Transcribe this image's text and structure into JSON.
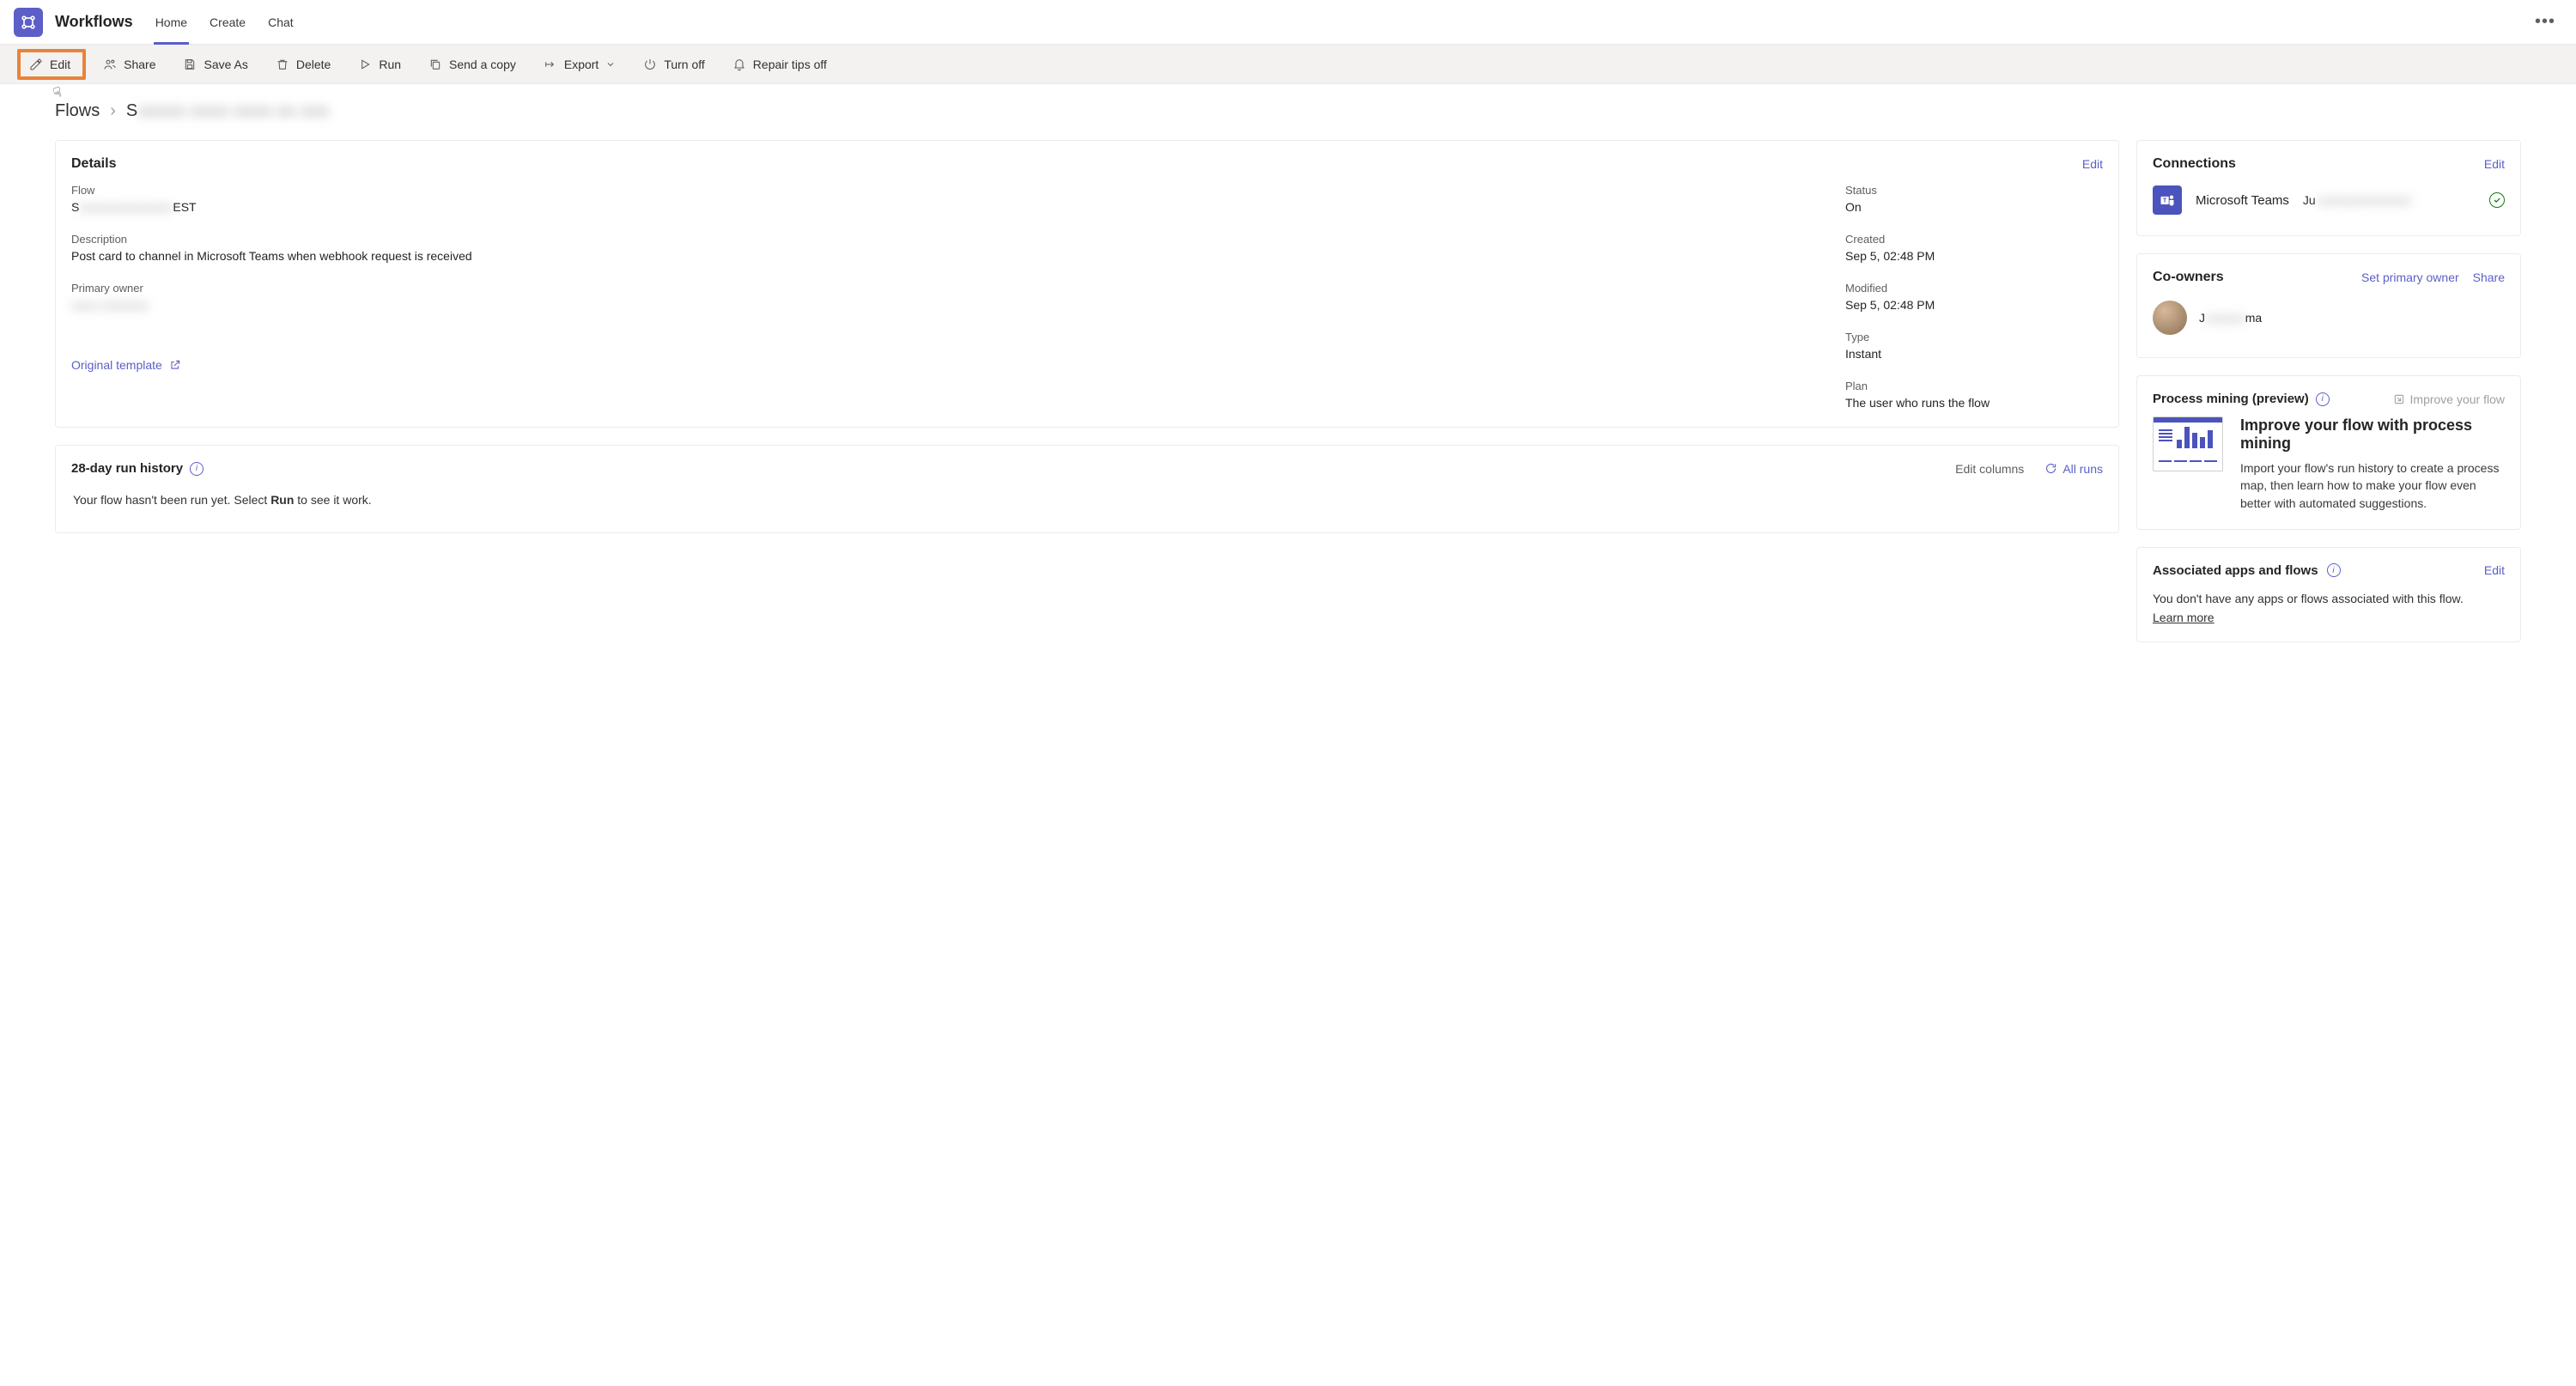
{
  "app": {
    "title": "Workflows"
  },
  "nav": {
    "tabs": {
      "home": "Home",
      "create": "Create",
      "chat": "Chat"
    }
  },
  "toolbar": {
    "edit": "Edit",
    "share": "Share",
    "save_as": "Save As",
    "delete": "Delete",
    "run": "Run",
    "send_copy": "Send a copy",
    "export": "Export",
    "turn_off": "Turn off",
    "repair_tips_off": "Repair tips off"
  },
  "breadcrumb": {
    "flows": "Flows",
    "current_prefix": "S",
    "current_blurred": "aaaaa aaaa aaaa aa aaa"
  },
  "details": {
    "title": "Details",
    "edit": "Edit",
    "flow_label": "Flow",
    "flow_value_prefix": "S",
    "flow_value_blurred": "aaaaaaaaaaaaaa",
    "flow_value_suffix": "EST",
    "description_label": "Description",
    "description_value": "Post card to channel in Microsoft Teams when webhook request is received",
    "primary_owner_label": "Primary owner",
    "primary_owner_value": "aaaa aaaaaaa",
    "status_label": "Status",
    "status_value": "On",
    "created_label": "Created",
    "created_value": "Sep 5, 02:48 PM",
    "modified_label": "Modified",
    "modified_value": "Sep 5, 02:48 PM",
    "type_label": "Type",
    "type_value": "Instant",
    "plan_label": "Plan",
    "plan_value": "The user who runs the flow",
    "original_template": "Original template"
  },
  "runhist": {
    "title": "28-day run history",
    "edit_columns": "Edit columns",
    "all_runs": "All runs",
    "empty_pre": "Your flow hasn't been run yet. Select ",
    "empty_bold": "Run",
    "empty_post": " to see it work."
  },
  "connections": {
    "title": "Connections",
    "edit": "Edit",
    "item_name": "Microsoft Teams",
    "item_account_prefix": "Ju",
    "item_account_blurred": "aaaaaaaaaaaaaa"
  },
  "coowners": {
    "title": "Co-owners",
    "set_primary": "Set primary owner",
    "share": "Share",
    "owner_prefix": "J",
    "owner_blurred": "aaaaaa",
    "owner_suffix": "ma"
  },
  "pm": {
    "title": "Process mining (preview)",
    "improve_link": "Improve your flow",
    "card_title": "Improve your flow with process mining",
    "card_desc": "Import your flow's run history to create a process map, then learn how to make your flow even better with automated suggestions."
  },
  "assoc": {
    "title": "Associated apps and flows",
    "edit": "Edit",
    "text": "You don't have any apps or flows associated with this flow.",
    "learn_more": "Learn more"
  }
}
